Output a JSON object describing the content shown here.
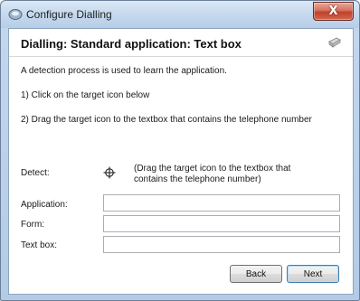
{
  "window": {
    "title": "Configure Dialling",
    "close_glyph": "X"
  },
  "header": {
    "title": "Dialling: Standard application: Text box",
    "icon": "wizard-icon"
  },
  "intro": "A detection process is used to learn the application.",
  "steps": [
    "1) Click on the target icon below",
    "2) Drag the target icon to the textbox that contains the telephone number"
  ],
  "detect": {
    "label": "Detect:",
    "icon": "crosshair-target-icon",
    "hint_line1": "(Drag the target icon to the textbox that",
    "hint_line2": "contains the telephone number)"
  },
  "fields": {
    "application": {
      "label": "Application:",
      "value": ""
    },
    "form": {
      "label": "Form:",
      "value": ""
    },
    "textbox": {
      "label": "Text box:",
      "value": ""
    }
  },
  "buttons": {
    "back": "Back",
    "next": "Next"
  }
}
